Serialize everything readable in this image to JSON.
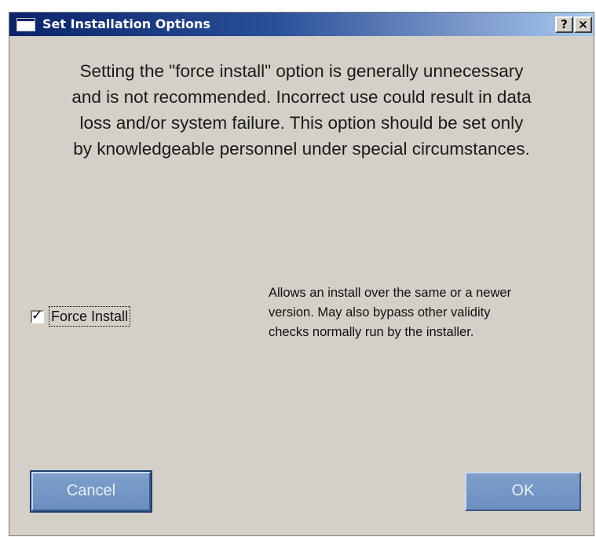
{
  "window": {
    "title": "Set Installation Options",
    "help_button": "?",
    "close_button": "×",
    "title_icon": "window-icon"
  },
  "warning": {
    "lines": [
      "Setting the \"force install\" option is generally unnecessary",
      "and is not recommended. Incorrect use could result in data",
      "loss and/or system failure. This option should be set only",
      "by knowledgeable personnel under special circumstances."
    ]
  },
  "force_install": {
    "label": "Force Install",
    "checked": true,
    "check_glyph": "✓",
    "description_lines": [
      "Allows an install over the same or a newer",
      "version. May also bypass other validity",
      "checks normally run by the installer."
    ]
  },
  "buttons": {
    "cancel_label": "Cancel",
    "ok_label": "OK"
  },
  "colors": {
    "dialog_bg": "#d4d0c8",
    "titlebar_start": "#0a246a",
    "titlebar_end": "#a6caf0",
    "button_bg": "#7e9fca"
  }
}
